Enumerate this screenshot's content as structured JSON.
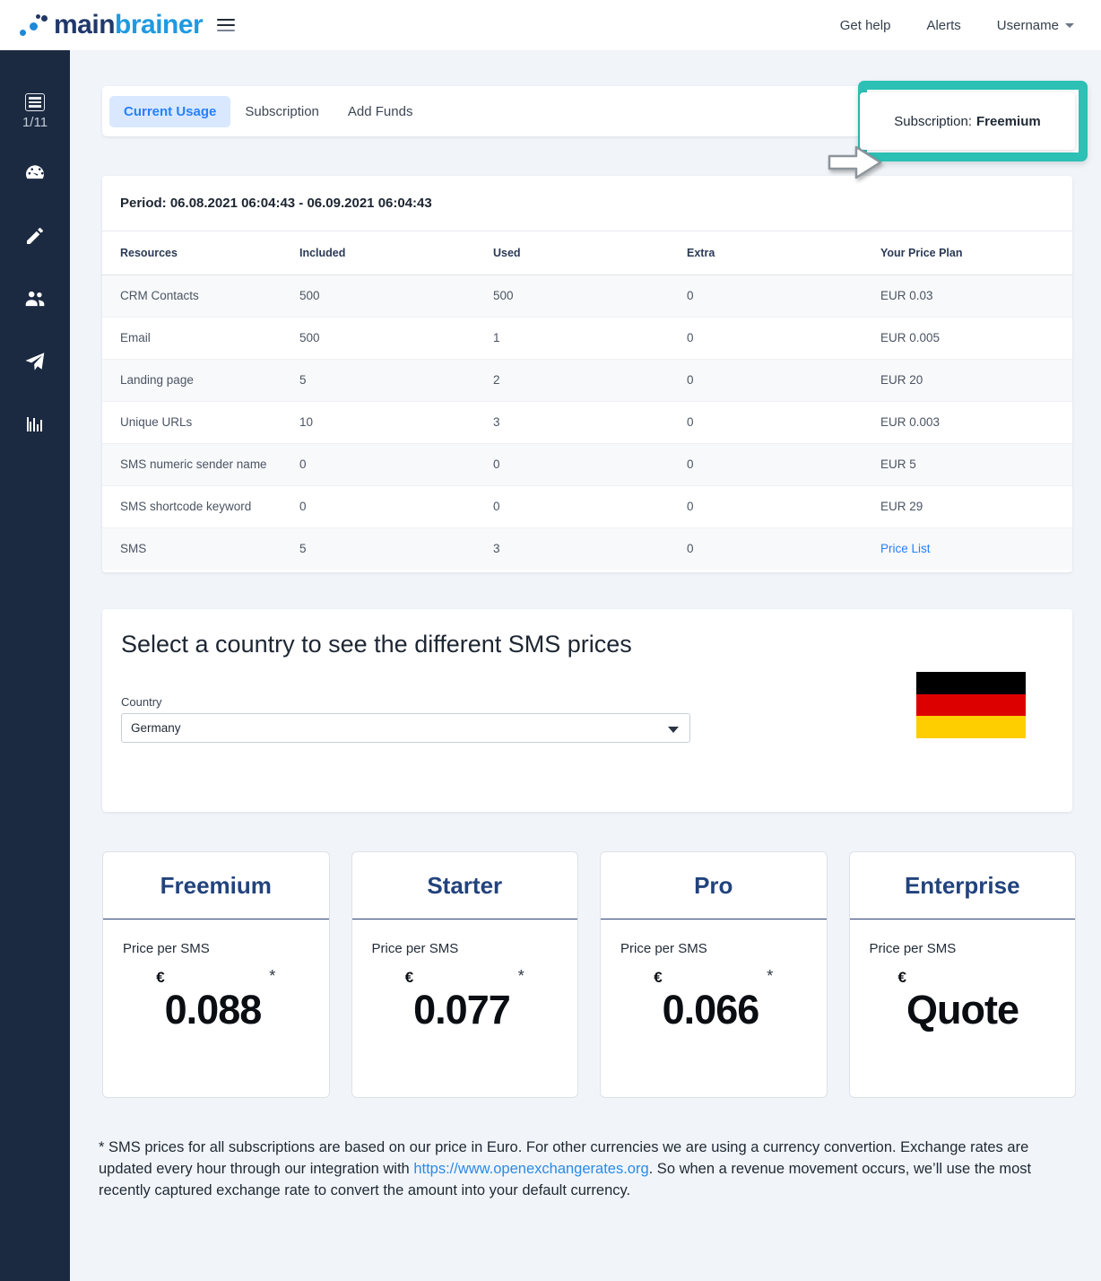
{
  "brand": {
    "part1": "main",
    "part2": "brainer"
  },
  "topnav": {
    "get_help": "Get help",
    "alerts": "Alerts",
    "username": "Username"
  },
  "sidebar": {
    "counter": "1/11",
    "icons": [
      "list-icon",
      "dashboard-gauge-icon",
      "pencil-icon",
      "people-icon",
      "paper-plane-icon",
      "bar-chart-icon"
    ]
  },
  "tabs": [
    {
      "label": "Current Usage",
      "active": true
    },
    {
      "label": "Subscription",
      "active": false
    },
    {
      "label": "Add Funds",
      "active": false
    }
  ],
  "subscription_badge": {
    "prefix": "Subscription:",
    "value": "Freemium",
    "highlight_color": "#2dc0b5"
  },
  "usage": {
    "period": "Period: 06.08.2021 06:04:43 - 06.09.2021 06:04:43",
    "columns": [
      "Resources",
      "Included",
      "Used",
      "Extra",
      "Your Price Plan"
    ],
    "rows": [
      {
        "resource": "CRM Contacts",
        "included": "500",
        "used": "500",
        "extra": "0",
        "plan": "EUR 0.03",
        "plan_is_link": false
      },
      {
        "resource": "Email",
        "included": "500",
        "used": "1",
        "extra": "0",
        "plan": "EUR 0.005",
        "plan_is_link": false
      },
      {
        "resource": "Landing page",
        "included": "5",
        "used": "2",
        "extra": "0",
        "plan": "EUR 20",
        "plan_is_link": false
      },
      {
        "resource": "Unique URLs",
        "included": "10",
        "used": "3",
        "extra": "0",
        "plan": "EUR 0.003",
        "plan_is_link": false
      },
      {
        "resource": "SMS numeric sender name",
        "included": "0",
        "used": "0",
        "extra": "0",
        "plan": "EUR 5",
        "plan_is_link": false
      },
      {
        "resource": "SMS shortcode keyword",
        "included": "0",
        "used": "0",
        "extra": "0",
        "plan": "EUR 29",
        "plan_is_link": false
      },
      {
        "resource": "SMS",
        "included": "5",
        "used": "3",
        "extra": "0",
        "plan": "Price List",
        "plan_is_link": true
      }
    ]
  },
  "country_section": {
    "title": "Select a country to see the different SMS prices",
    "label": "Country",
    "selected": "Germany",
    "flag": {
      "name": "germany-flag",
      "colors": [
        "#000000",
        "#DD0000",
        "#FFCE00"
      ]
    }
  },
  "plans": [
    {
      "name": "Freemium",
      "sub": "Price per SMS",
      "currency": "€",
      "amount": "0.088",
      "star": "*"
    },
    {
      "name": "Starter",
      "sub": "Price per SMS",
      "currency": "€",
      "amount": "0.077",
      "star": "*"
    },
    {
      "name": "Pro",
      "sub": "Price per SMS",
      "currency": "€",
      "amount": "0.066",
      "star": "*"
    },
    {
      "name": "Enterprise",
      "sub": "Price per SMS",
      "currency": "€",
      "amount": "Quote",
      "star": ""
    }
  ],
  "footnote": {
    "part1": "* SMS prices for all subscriptions are based on our price in Euro. For other currencies we are using a currency convertion. Exchange rates are updated every hour through our integration with ",
    "link": "https://www.openexchangerates.org",
    "part2": ". So when a revenue movement occurs, we’ll use the most recently captured exchange rate to convert the amount into your default currency."
  }
}
